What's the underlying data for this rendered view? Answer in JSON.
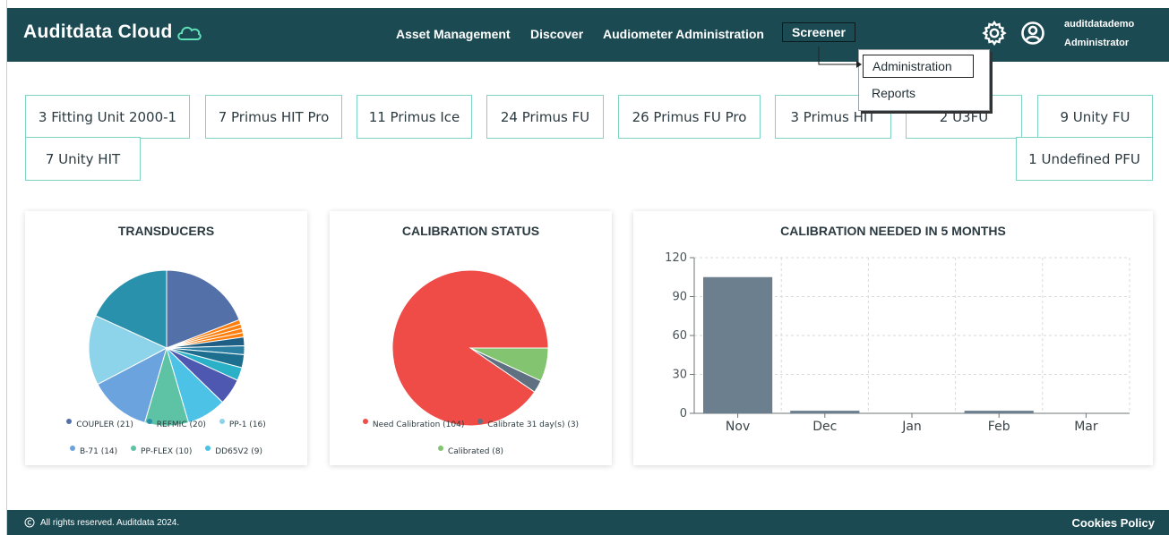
{
  "header": {
    "logo": "Auditdata Cloud",
    "nav": [
      "Asset Management",
      "Discover",
      "Audiometer Administration",
      "Screener"
    ],
    "active_nav": "Screener",
    "user": {
      "name": "auditdatademo",
      "role": "Administrator"
    },
    "settings_icon": "gear-icon",
    "profile_icon": "user-circle-icon",
    "colors": {
      "header_bg": "#1c4a52",
      "chip_border": "#7fd3c3"
    }
  },
  "dropdown": {
    "items": [
      "Administration",
      "Reports"
    ],
    "selected": "Administration"
  },
  "chips": [
    "3 Fitting Unit 2000-1",
    "7 Primus HIT Pro",
    "11 Primus Ice",
    "24 Primus FU",
    "26 Primus FU Pro",
    "3 Primus HIT",
    "2 U3FU",
    "9 Unity FU",
    "7 Unity HIT",
    "1 Undefined PFU"
  ],
  "chart_data": [
    {
      "type": "pie",
      "title": "TRANSDUCERS",
      "legend": [
        {
          "label": "COUPLER (21)",
          "color": "#5470a8"
        },
        {
          "label": "REFMIC (20)",
          "color": "#2a91ad"
        },
        {
          "label": "PP-1 (16)",
          "color": "#8dd3ea"
        },
        {
          "label": "B-71 (14)",
          "color": "#6aa3dd"
        },
        {
          "label": "PP-FLEX (10)",
          "color": "#5ec2a4"
        },
        {
          "label": "DD65V2 (9)",
          "color": "#4cc3e6"
        }
      ],
      "slices": [
        {
          "label": "COUPLER",
          "value": 21,
          "color": "#5470a8"
        },
        {
          "label": "",
          "value": 1,
          "color": "#ff7f0e"
        },
        {
          "label": "",
          "value": 1,
          "color": "#ff7f0e"
        },
        {
          "label": "",
          "value": 1,
          "color": "#ff7f0e"
        },
        {
          "label": "",
          "value": 1,
          "color": "#ff7f0e"
        },
        {
          "label": "",
          "value": 2,
          "color": "#1f5f85"
        },
        {
          "label": "",
          "value": 2,
          "color": "#2a7fa3"
        },
        {
          "label": "",
          "value": 3,
          "color": "#1d6f8f"
        },
        {
          "label": "",
          "value": 3,
          "color": "#2ab1c8"
        },
        {
          "label": "",
          "value": 6,
          "color": "#4e58b0"
        },
        {
          "label": "DD65V2",
          "value": 9,
          "color": "#4cc3e6"
        },
        {
          "label": "PP-FLEX",
          "value": 10,
          "color": "#5ec2a4"
        },
        {
          "label": "B-71",
          "value": 14,
          "color": "#6aa3dd"
        },
        {
          "label": "PP-1",
          "value": 16,
          "color": "#8dd3ea"
        },
        {
          "label": "REFMIC",
          "value": 20,
          "color": "#2a91ad"
        }
      ]
    },
    {
      "type": "pie",
      "title": "CALIBRATION STATUS",
      "legend": [
        {
          "label": "Need Calibration (104)",
          "color": "#ef4b47"
        },
        {
          "label": "Calibrate 31 day(s) (3)",
          "color": "#5f7081"
        },
        {
          "label": "Calibrated (8)",
          "color": "#82c46f"
        }
      ],
      "slices": [
        {
          "label": "Calibrated",
          "value": 8,
          "color": "#82c46f"
        },
        {
          "label": "Calibrate 31 day(s)",
          "value": 3,
          "color": "#5f7081"
        },
        {
          "label": "Need Calibration",
          "value": 104,
          "color": "#ef4b47"
        }
      ]
    },
    {
      "type": "bar",
      "title": "CALIBRATION NEEDED IN 5 MONTHS",
      "categories": [
        "Nov",
        "Dec",
        "Jan",
        "Feb",
        "Mar"
      ],
      "values": [
        105,
        2,
        0,
        2,
        0
      ],
      "yticks": [
        0,
        30,
        60,
        90,
        120
      ],
      "ylim": [
        0,
        120
      ],
      "grid": true,
      "bar_color": "#6b7f8e"
    }
  ],
  "footer": {
    "copyright": "All rights reserved. Auditdata 2024.",
    "cookies": "Cookies Policy"
  }
}
